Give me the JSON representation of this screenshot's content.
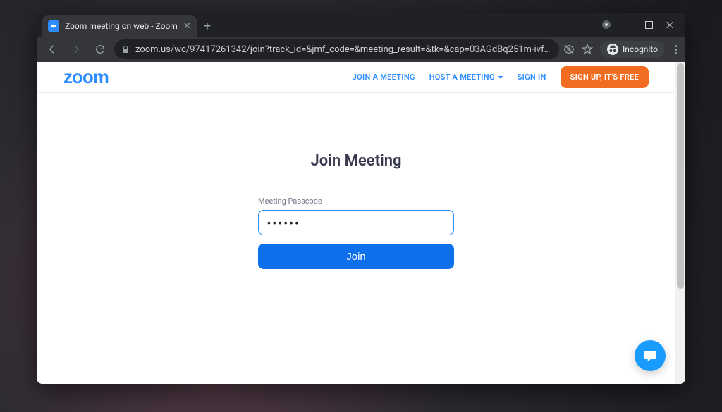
{
  "browser": {
    "tab_title": "Zoom meeting on web - Zoom",
    "url_display": "zoom.us/wc/97417261342/join?track_id=&jmf_code=&meeting_result=&tk=&cap=03AGdBq251m-ivfoCaTqyKaEDjmO6hDgDo6hbgJtOwCorn1FOav...",
    "incognito_label": "Incognito"
  },
  "header": {
    "logo_text": "zoom",
    "join_meeting": "JOIN A MEETING",
    "host_meeting": "HOST A MEETING",
    "sign_in": "SIGN IN",
    "sign_up": "SIGN UP, IT'S FREE"
  },
  "main": {
    "title": "Join Meeting",
    "passcode_label": "Meeting Passcode",
    "passcode_value": "••••••",
    "join_button": "Join"
  }
}
